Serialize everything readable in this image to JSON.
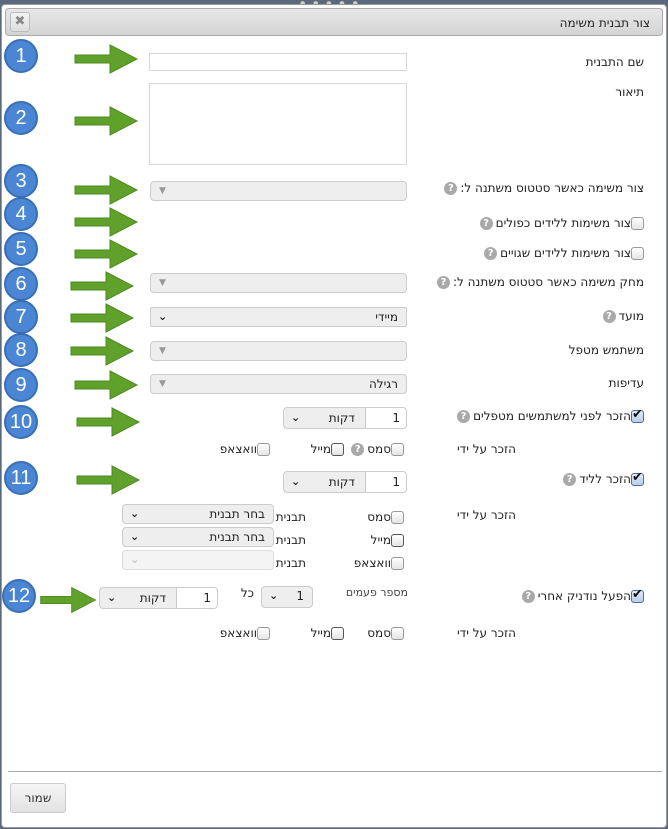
{
  "dialog": {
    "title": "צור תבנית משימה",
    "close_icon": "close-icon",
    "save_label": "שמור"
  },
  "fields": {
    "template_name_label": "שם התבנית",
    "template_name_value": "",
    "description_label": "תיאור",
    "description_value": "",
    "create_on_status_label": "צור משימה כאשר סטטוס משתנה ל:",
    "create_on_status_value": "",
    "duplicate_leads_label": "צור משימות ללידים כפולים",
    "duplicate_leads_checked": false,
    "wrong_leads_label": "צור משימות ללידים שגויים",
    "wrong_leads_checked": false,
    "delete_on_status_label": "מחק משימה כאשר סטטוס משתנה ל:",
    "delete_on_status_value": "",
    "due_label": "מועד",
    "due_value": "מיידי",
    "handler_label": "משתמש מטפל",
    "handler_value": "",
    "priority_label": "עדיפות",
    "priority_value": "רגילה"
  },
  "remind_handlers": {
    "label": "הזכר לפני למשתמשים מטפלים",
    "checked": true,
    "amount": "1",
    "unit": "דקות",
    "by_label": "הזכר על ידי",
    "sms_label": "סמס",
    "mail_label": "מייל",
    "whatsapp_label": "וואצאפ"
  },
  "remind_lead": {
    "label": "הזכר לליד",
    "checked": true,
    "amount": "1",
    "unit": "דקות",
    "by_label": "הזכר על ידי",
    "channels": [
      {
        "label": "סמס",
        "template_label": "תבנית",
        "template_value": "בחר תבנית"
      },
      {
        "label": "מייל",
        "template_label": "תבנית",
        "template_value": "בחר תבנית"
      },
      {
        "label": "וואצאפ",
        "template_label": "תבנית",
        "template_value": ""
      }
    ]
  },
  "nudnik": {
    "label": "הפעל נודניק אחרי",
    "checked": true,
    "times_label": "מספר פעמים",
    "times_value": "1",
    "every_label": "כל",
    "amount": "1",
    "unit": "דקות",
    "by_label": "הזכר על ידי",
    "sms_label": "סמס",
    "mail_label": "מייל",
    "whatsapp_label": "וואצאפ"
  },
  "annotations": [
    "1",
    "2",
    "3",
    "4",
    "5",
    "6",
    "7",
    "8",
    "9",
    "10",
    "11",
    "12"
  ],
  "colors": {
    "badge": "#4a86d4",
    "arrow": "#5fa12a"
  }
}
